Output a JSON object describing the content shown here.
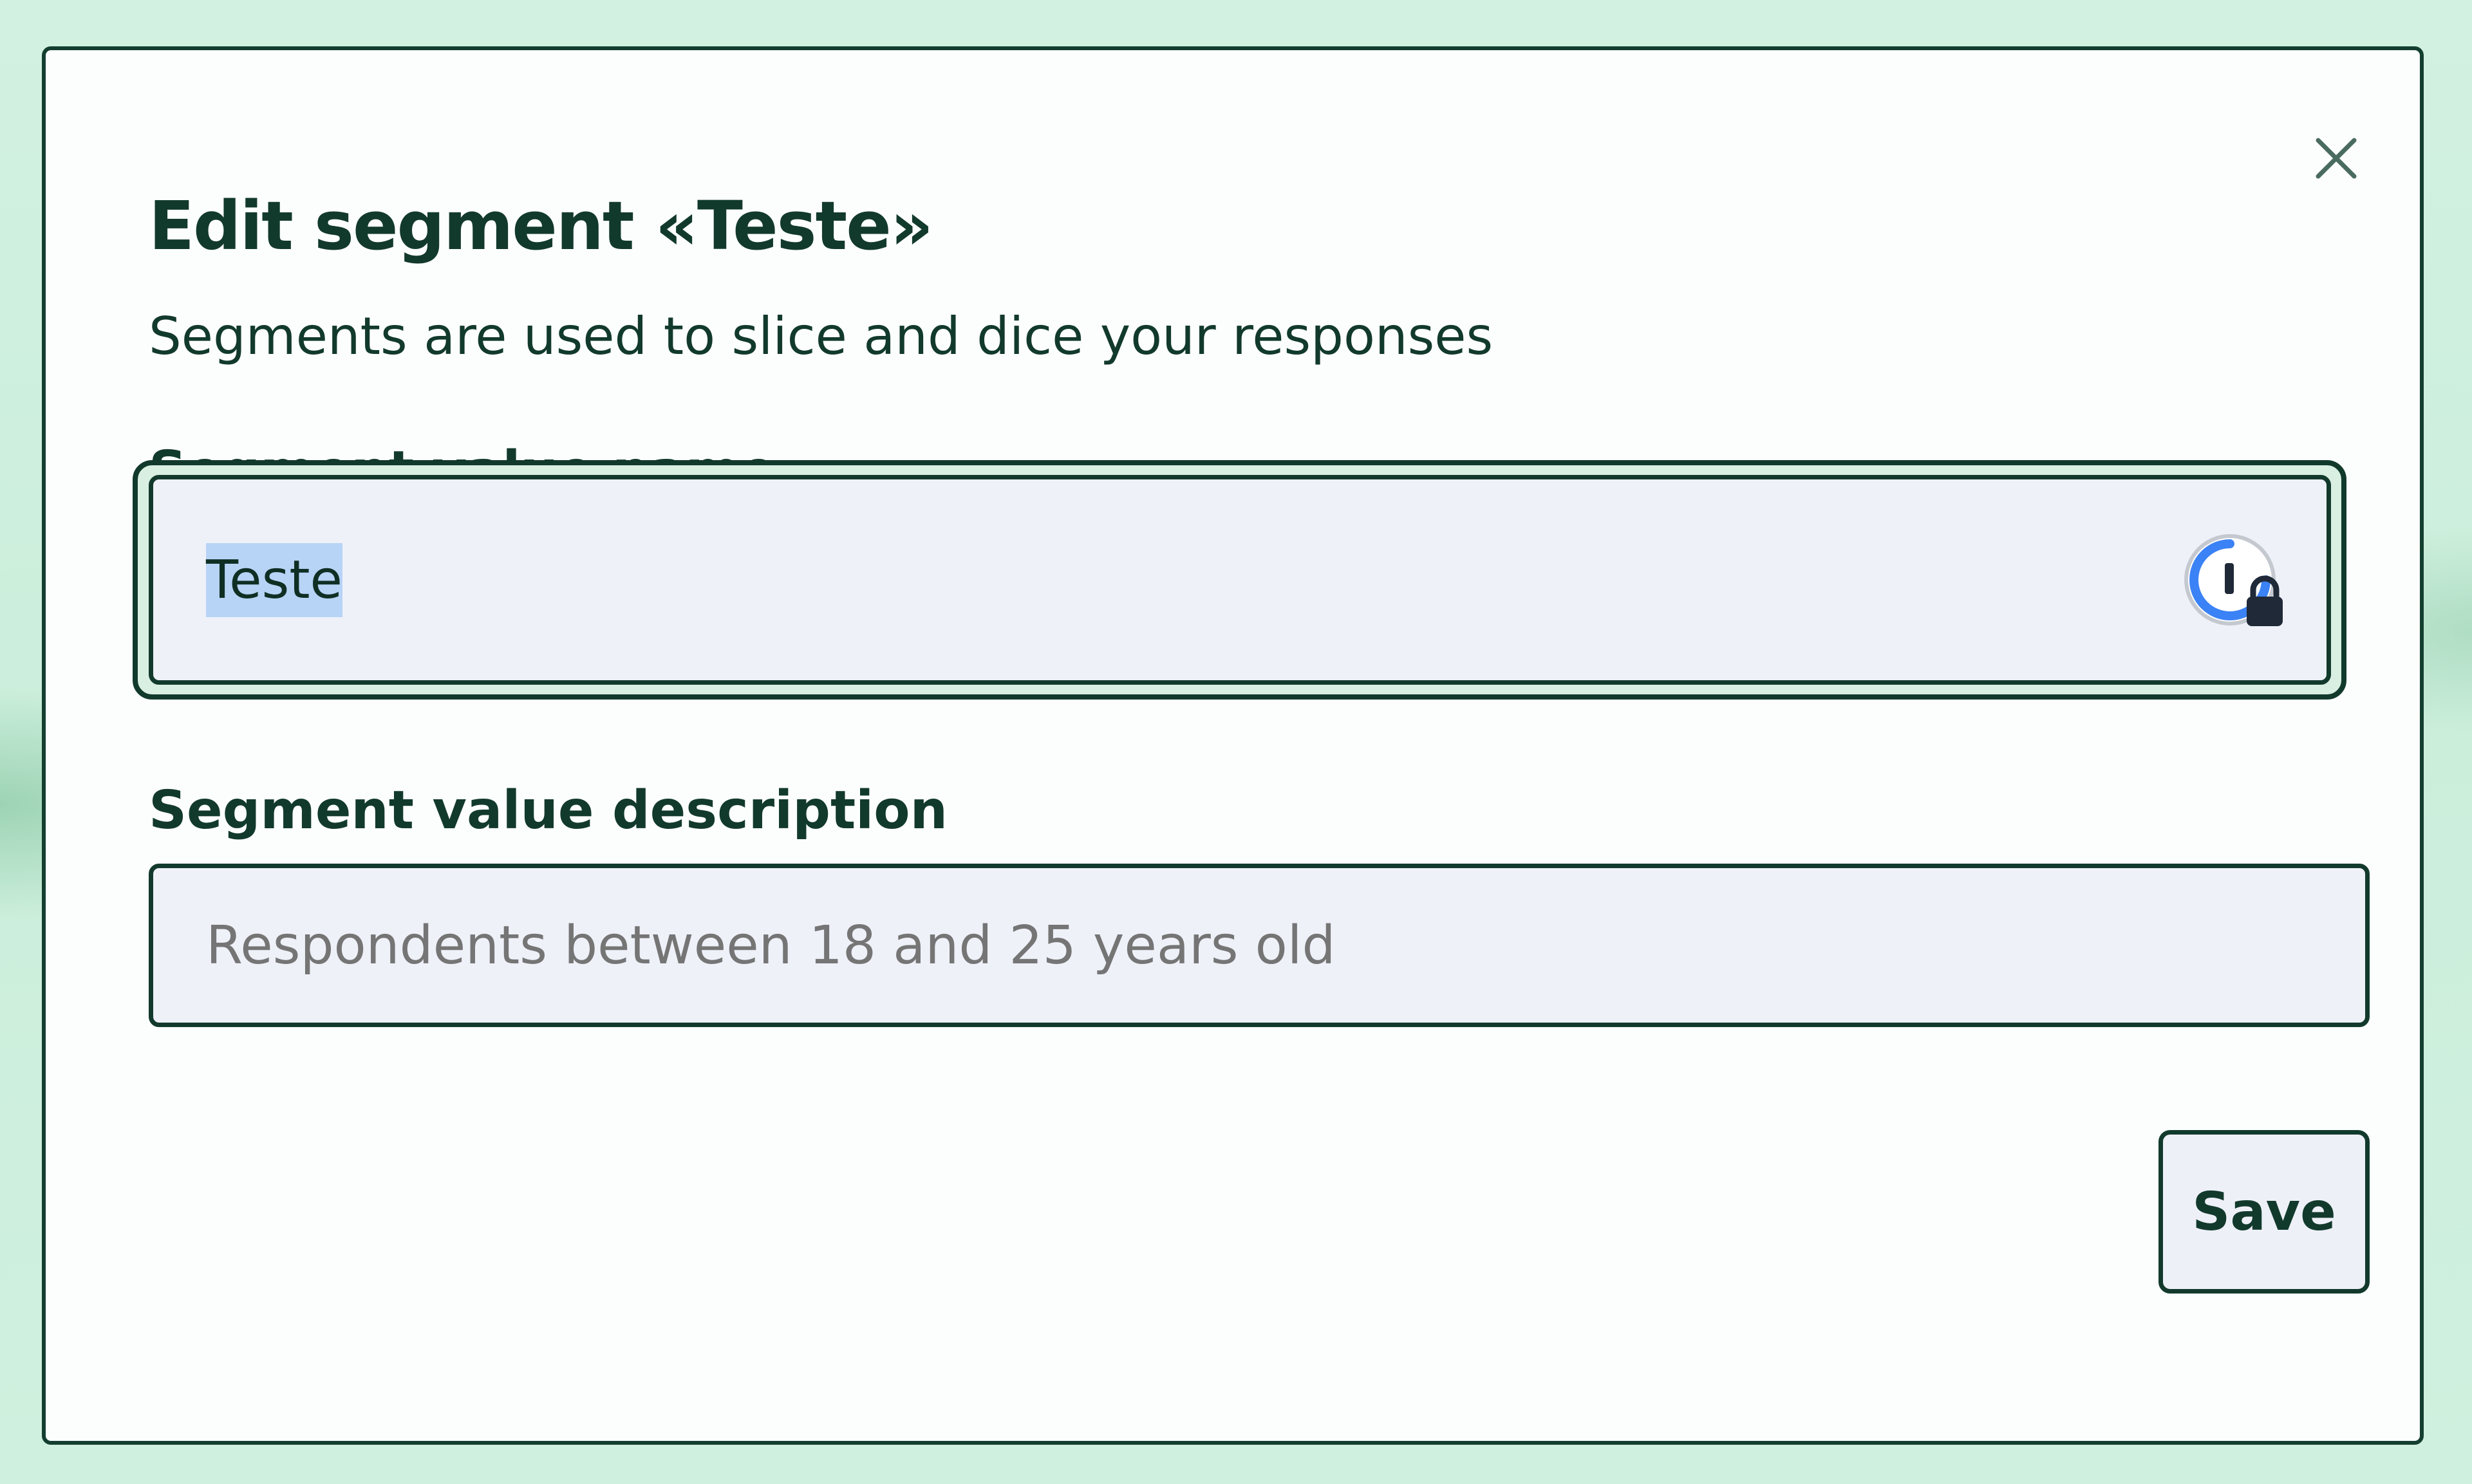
{
  "dialog": {
    "title": "Edit segment «Teste»",
    "subtitle": "Segments are used to slice and dice your responses",
    "close_icon": "close-icon",
    "name_field": {
      "label": "Segment value name",
      "value": "Teste",
      "selected": true,
      "icon": "password-manager-icon"
    },
    "description_field": {
      "label": "Segment value description",
      "placeholder": "Respondents between 18 and 25 years old",
      "value": ""
    },
    "save_label": "Save"
  },
  "colors": {
    "backdrop": "#cdeedd",
    "modal_bg": "#fcfefd",
    "text_dark_green": "#123a2c",
    "input_bg": "#eff1f9",
    "selection": "#b7d3f6",
    "placeholder": "#8a9a92",
    "password_manager_blue": "#3b82f6"
  }
}
